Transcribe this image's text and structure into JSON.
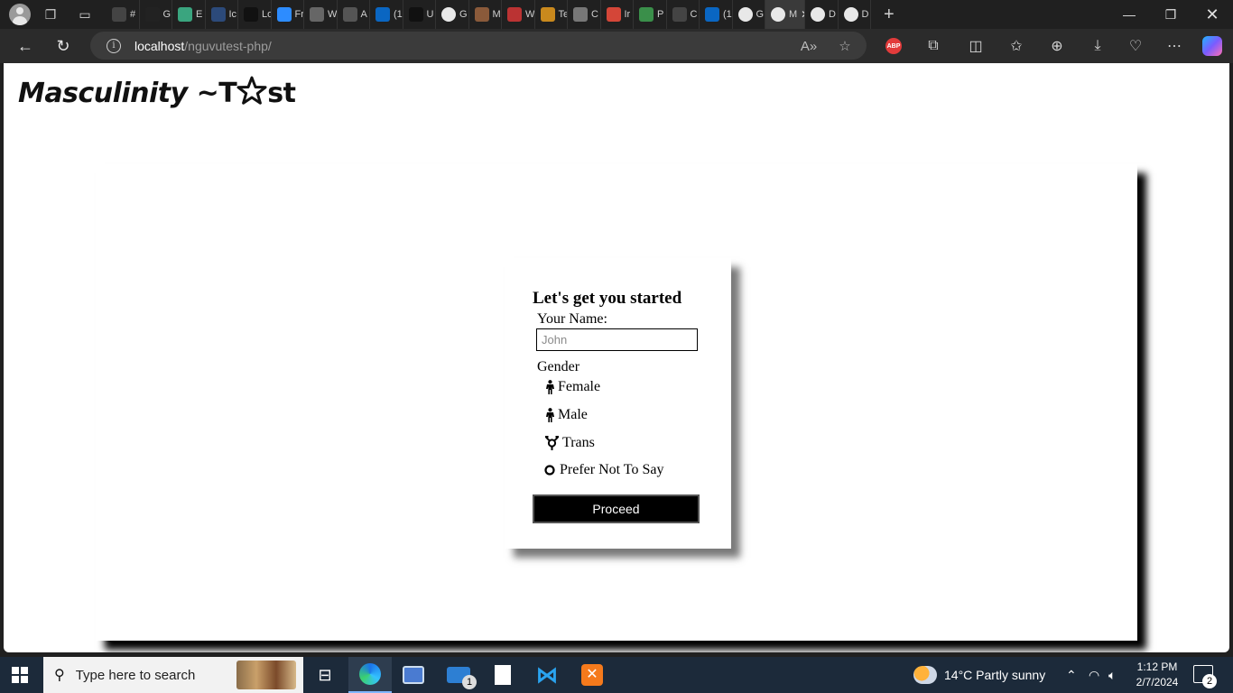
{
  "browser": {
    "tabs": [
      {
        "title": "#",
        "favicon": "speaker-icon"
      },
      {
        "title": "G",
        "favicon": "tt-icon"
      },
      {
        "title": "E",
        "favicon": "chatgpt-icon"
      },
      {
        "title": "Ic",
        "favicon": "flag-icon"
      },
      {
        "title": "Lo",
        "favicon": "x-icon"
      },
      {
        "title": "Fr",
        "favicon": "blue-dot-icon"
      },
      {
        "title": "W",
        "favicon": "document-icon"
      },
      {
        "title": "A",
        "favicon": "notion-icon"
      },
      {
        "title": "(1",
        "favicon": "linkedin-icon"
      },
      {
        "title": "U",
        "favicon": "code-icon"
      },
      {
        "title": "G",
        "favicon": "github-icon"
      },
      {
        "title": "M",
        "favicon": "mosaic-icon"
      },
      {
        "title": "W",
        "favicon": "pdf-icon"
      },
      {
        "title": "Te",
        "favicon": "star-coin-icon"
      },
      {
        "title": "C",
        "favicon": "printer-icon"
      },
      {
        "title": "Ir",
        "favicon": "gmail-icon"
      },
      {
        "title": "P",
        "favicon": "pinwheel-icon"
      },
      {
        "title": "C",
        "favicon": "anthropic-icon"
      },
      {
        "title": "(1",
        "favicon": "linkedin-icon"
      },
      {
        "title": "G",
        "favicon": "github-icon"
      }
    ],
    "active_tab": {
      "title": "M",
      "favicon": "github-icon"
    },
    "trailing_tabs": [
      {
        "title": "D",
        "favicon": "github-icon"
      },
      {
        "title": "D",
        "favicon": "github-icon"
      }
    ],
    "url_host": "localhost",
    "url_path": "/nguvutest-php/",
    "extension_abp": "ABP"
  },
  "page": {
    "site_title_left": "Masculinity ~",
    "site_title_t": "T",
    "site_title_right": "st",
    "form_title": "Let's get you started",
    "name_label": "Your Name:",
    "name_placeholder": "John",
    "name_value": "",
    "gender_label": "Gender",
    "gender_options": [
      {
        "label": "Female",
        "icon": "person-icon"
      },
      {
        "label": "Male",
        "icon": "person-icon"
      },
      {
        "label": "Trans",
        "icon": "transgender-icon"
      },
      {
        "label": "Prefer Not To Say",
        "icon": "circle-icon"
      }
    ],
    "submit_label": "Proceed"
  },
  "taskbar": {
    "search_placeholder": "Type here to search",
    "weather": "14°C  Partly sunny",
    "time": "1:12 PM",
    "date": "2/7/2024",
    "mail_badge": "1",
    "notification_count": "2"
  }
}
